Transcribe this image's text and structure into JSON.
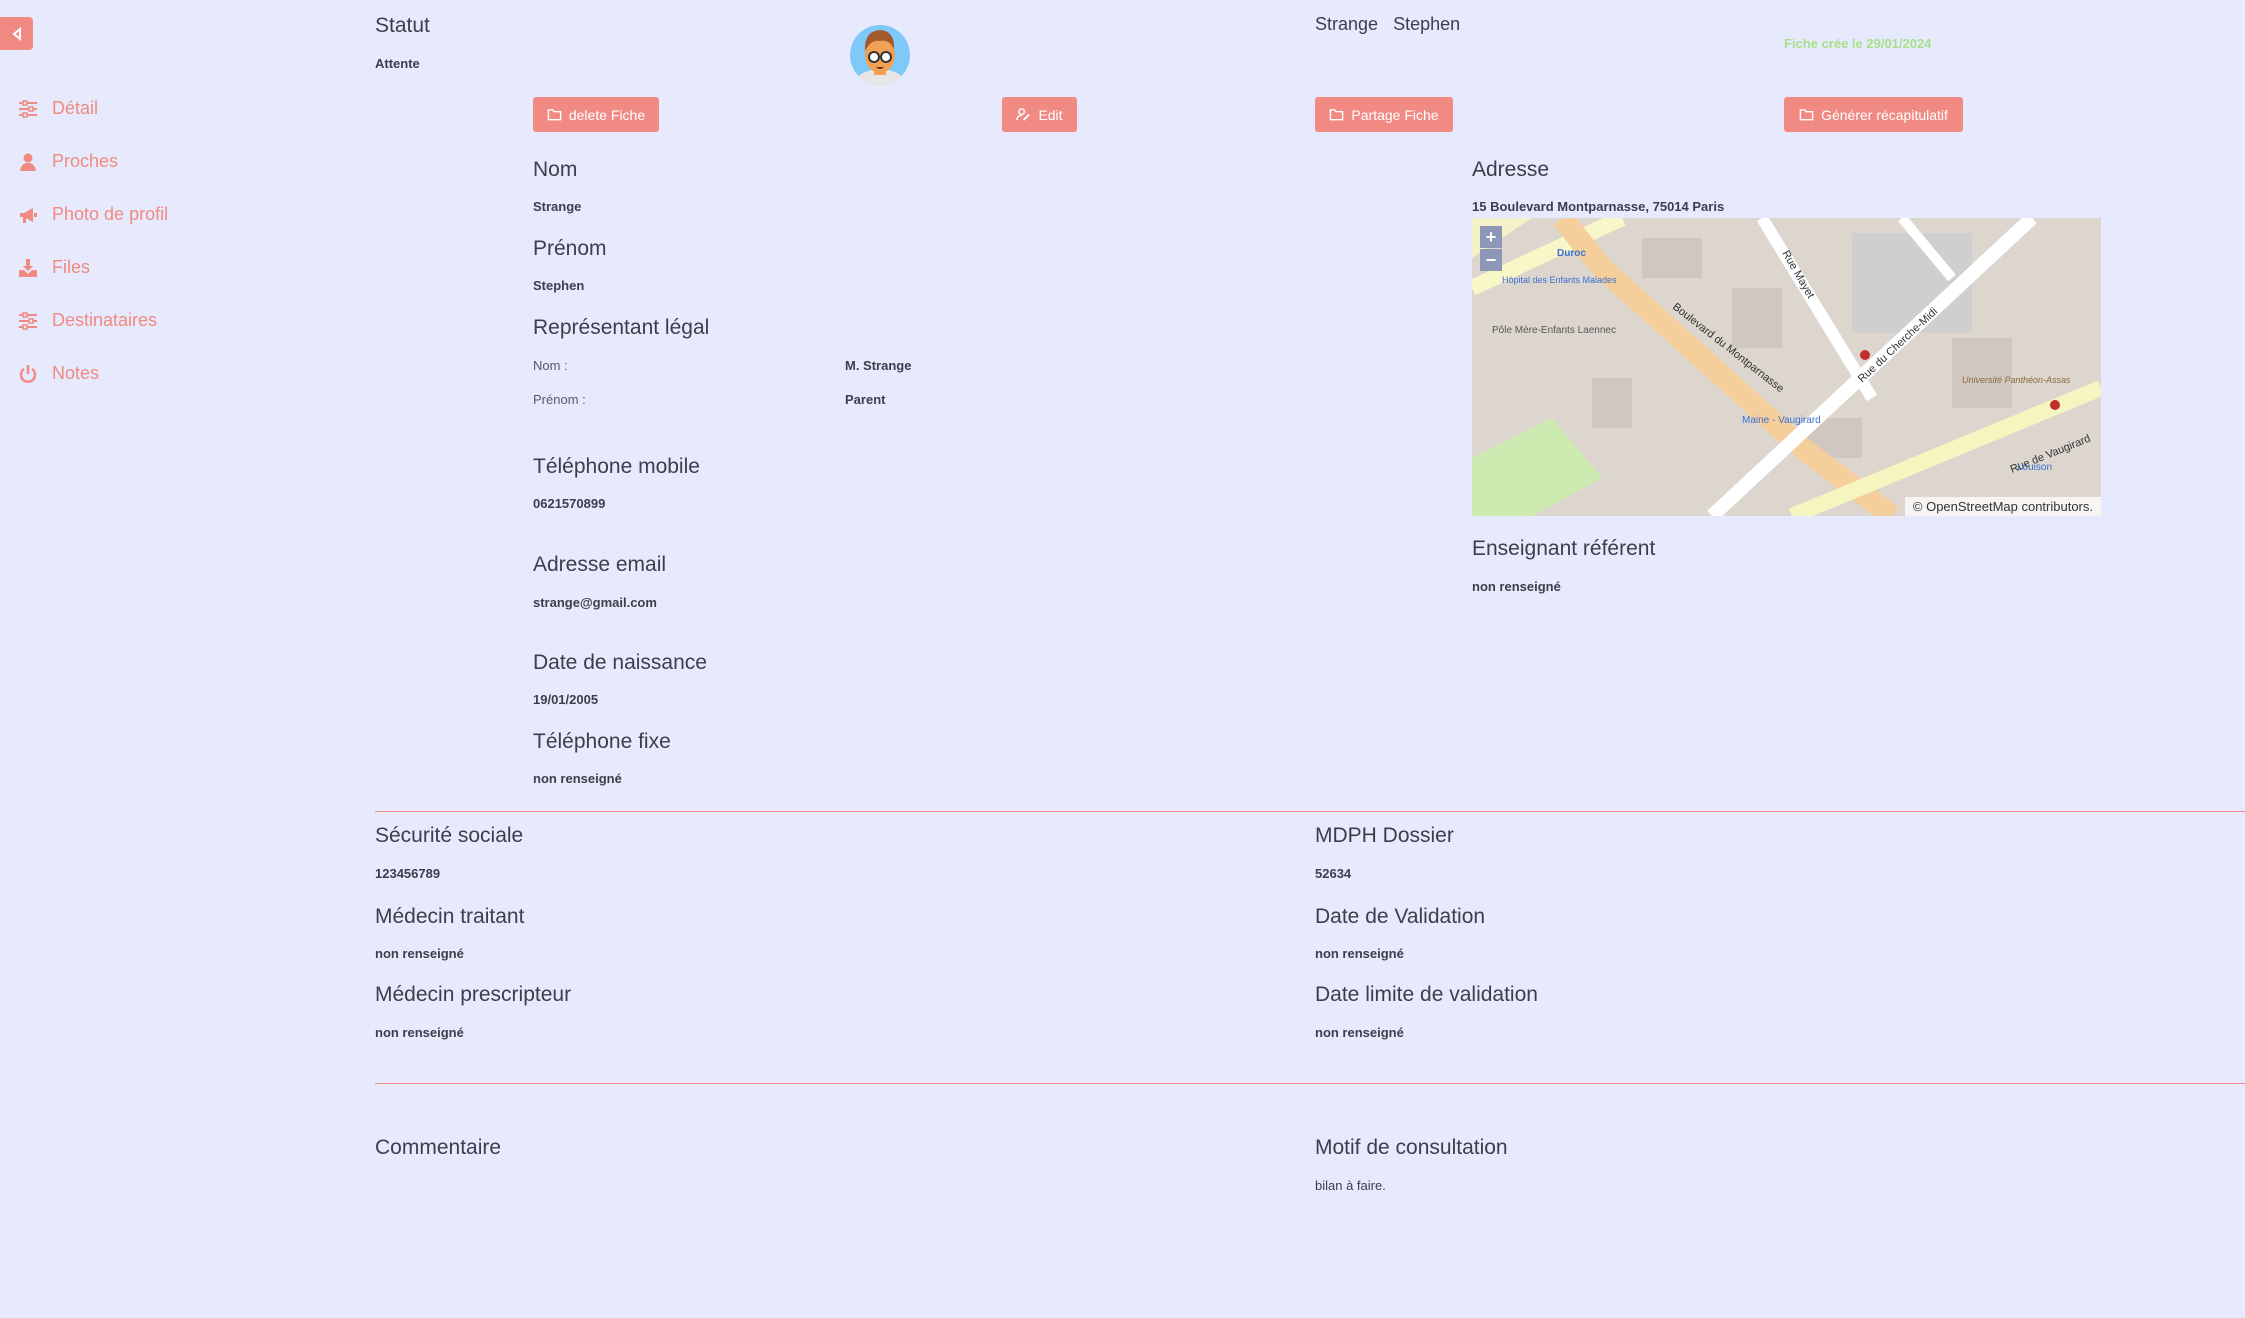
{
  "sidebar": {
    "items": [
      {
        "label": "Détail",
        "icon": "sliders-icon"
      },
      {
        "label": "Proches",
        "icon": "user-icon"
      },
      {
        "label": "Photo de profil",
        "icon": "megaphone-icon"
      },
      {
        "label": "Files",
        "icon": "download-icon"
      },
      {
        "label": "Destinataires",
        "icon": "sliders-icon"
      },
      {
        "label": "Notes",
        "icon": "power-icon"
      }
    ]
  },
  "header": {
    "statut_title": "Statut",
    "statut_value": "Attente",
    "nom": "Strange",
    "prenom": "Stephen",
    "created": "Fiche crée le 29/01/2024"
  },
  "buttons": {
    "delete": "delete Fiche",
    "edit": "Edit",
    "share": "Partage Fiche",
    "generate": "Générer récapitulatif"
  },
  "identity": {
    "nom_title": "Nom",
    "nom_value": "Strange",
    "prenom_title": "Prénom",
    "prenom_value": "Stephen",
    "rep_title": "Représentant légal",
    "rep_nom_label": "Nom :",
    "rep_nom_value": "M. Strange",
    "rep_prenom_label": "Prénom :",
    "rep_prenom_value": "Parent",
    "mobile_title": "Téléphone mobile",
    "mobile_value": "0621570899",
    "email_title": "Adresse email",
    "email_value": "strange@gmail.com",
    "birth_title": "Date de naissance",
    "birth_value": "19/01/2005",
    "fixe_title": "Téléphone fixe",
    "fixe_value": "non renseigné"
  },
  "address": {
    "title": "Adresse",
    "value": "15 Boulevard Montparnasse, 75014 Paris",
    "map": {
      "zoom_in": "+",
      "zoom_out": "−",
      "attribution": "© OpenStreetMap contributors.",
      "labels": [
        "Boulevard du Montparnasse",
        "Rue du Cherche-Midi",
        "Rue Mayet",
        "Rue de Vaugirard",
        "Duroc",
        "Hôpital des Enfants Malades",
        "Pôle Mère-Enfants Laennec",
        "Maine - Vaugirard",
        "Université Panthéon-Assas",
        "Louison"
      ]
    },
    "teacher_title": "Enseignant référent",
    "teacher_value": "non renseigné"
  },
  "medical": {
    "secu_title": "Sécurité sociale",
    "secu_value": "123456789",
    "medecin_title": "Médecin traitant",
    "medecin_value": "non renseigné",
    "prescripteur_title": "Médecin prescripteur",
    "prescripteur_value": "non renseigné",
    "mdph_title": "MDPH Dossier",
    "mdph_value": "52634",
    "validation_title": "Date de Validation",
    "validation_value": "non renseigné",
    "limite_title": "Date limite de validation",
    "limite_value": "non renseigné"
  },
  "notes": {
    "comment_title": "Commentaire",
    "motif_title": "Motif de consultation",
    "motif_value": "bilan à faire."
  },
  "colors": {
    "accent": "#f08a82",
    "background": "#e7eafd",
    "created": "#a8e08a"
  }
}
